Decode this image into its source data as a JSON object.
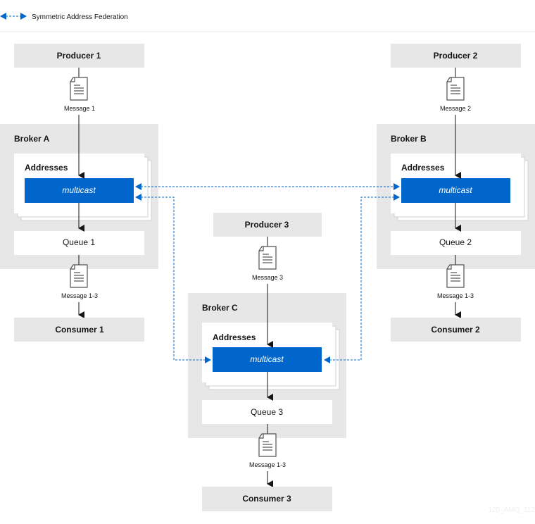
{
  "legend": {
    "label": "Symmetric Address Federation",
    "color": "#0066cc"
  },
  "colors": {
    "box_grey": "#e7e7e7",
    "multicast_blue": "#0066cc",
    "line_dark": "#151515",
    "stack_border": "#d2d2d2"
  },
  "producers": [
    {
      "label": "Producer 1"
    },
    {
      "label": "Producer 2"
    },
    {
      "label": "Producer 3"
    }
  ],
  "messages_in": [
    {
      "label": "Message 1",
      "icon": "document-icon"
    },
    {
      "label": "Message 2",
      "icon": "document-icon"
    },
    {
      "label": "Message 3",
      "icon": "document-icon"
    }
  ],
  "brokers": [
    {
      "label": "Broker A",
      "addresses_label": "Addresses",
      "address_type": "multicast",
      "queue": "Queue 1"
    },
    {
      "label": "Broker B",
      "addresses_label": "Addresses",
      "address_type": "multicast",
      "queue": "Queue 2"
    },
    {
      "label": "Broker C",
      "addresses_label": "Addresses",
      "address_type": "multicast",
      "queue": "Queue 3"
    }
  ],
  "messages_out": [
    {
      "label": "Message 1-3",
      "icon": "document-icon"
    },
    {
      "label": "Message 1-3",
      "icon": "document-icon"
    },
    {
      "label": "Message 1-3",
      "icon": "document-icon"
    }
  ],
  "consumers": [
    {
      "label": "Consumer 1"
    },
    {
      "label": "Consumer 2"
    },
    {
      "label": "Consumer 3"
    }
  ],
  "watermark": "120_AMQ_112"
}
